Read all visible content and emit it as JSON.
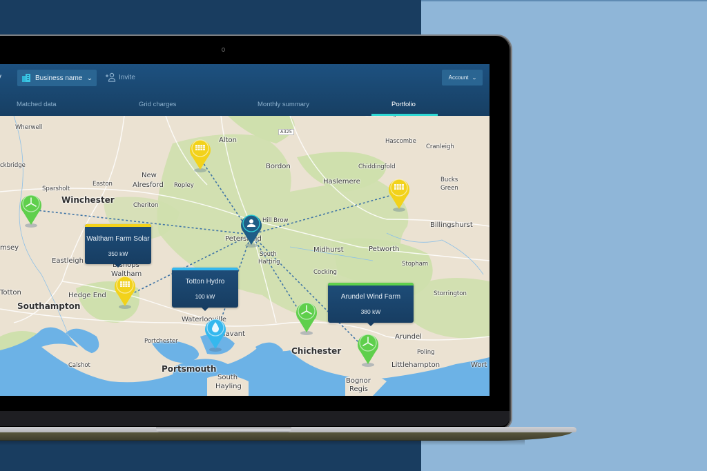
{
  "app": {
    "brand_fragment": "y",
    "business_selector": {
      "label": "Business name",
      "icon": "building-icon"
    },
    "invite": {
      "label": "Invite",
      "icon": "add-user-icon"
    },
    "account": {
      "label": "Account"
    }
  },
  "tabs": [
    {
      "label": "Matched data",
      "active": false
    },
    {
      "label": "Grid charges",
      "active": false
    },
    {
      "label": "Monthly summary",
      "active": false
    },
    {
      "label": "Portfolio",
      "active": true
    }
  ],
  "colors": {
    "accent_teal": "#2fd8d3",
    "solar": "#f2d21b",
    "wind": "#5fcf4c",
    "hydro": "#35b8ee",
    "hub": "#1f5d86",
    "header": "#1d5180",
    "water": "#6cb2e6"
  },
  "map": {
    "places": [
      {
        "name": "Wherwell",
        "size": "sm"
      },
      {
        "name": "Alton",
        "size": "md"
      },
      {
        "name": "A325",
        "size": "road"
      },
      {
        "name": "Godalming",
        "size": "sm"
      },
      {
        "name": "Hascombe",
        "size": "sm"
      },
      {
        "name": "Cranleigh",
        "size": "sm"
      },
      {
        "name": "ckbridge",
        "size": "sm"
      },
      {
        "name": "Bordon",
        "size": "md"
      },
      {
        "name": "Chiddingfold",
        "size": "sm"
      },
      {
        "name": "New",
        "size": "md"
      },
      {
        "name": "Alresford",
        "size": "md"
      },
      {
        "name": "Easton",
        "size": "sm"
      },
      {
        "name": "Ropley",
        "size": "sm"
      },
      {
        "name": "Haslemere",
        "size": "md"
      },
      {
        "name": "Bucks",
        "size": "sm"
      },
      {
        "name": "Green",
        "size": "sm"
      },
      {
        "name": "Sparsholt",
        "size": "sm"
      },
      {
        "name": "Winchester",
        "size": "lg"
      },
      {
        "name": "Cheriton",
        "size": "sm"
      },
      {
        "name": "Billingshurst",
        "size": "md"
      },
      {
        "name": "Hill Brow",
        "size": "sm"
      },
      {
        "name": "msey",
        "size": "md"
      },
      {
        "name": "Petersfield",
        "size": "md"
      },
      {
        "name": "Midhurst",
        "size": "md"
      },
      {
        "name": "Petworth",
        "size": "md"
      },
      {
        "name": "South",
        "size": "sm"
      },
      {
        "name": "Harting",
        "size": "sm"
      },
      {
        "name": "Eastleigh",
        "size": "md"
      },
      {
        "name": "Stopham",
        "size": "sm"
      },
      {
        "name": "Cocking",
        "size": "sm"
      },
      {
        "name": "Bishops",
        "size": "md"
      },
      {
        "name": "Waltham",
        "size": "md"
      },
      {
        "name": "Totton",
        "size": "md"
      },
      {
        "name": "Hedge End",
        "size": "md"
      },
      {
        "name": "Storrington",
        "size": "sm"
      },
      {
        "name": "Southampton",
        "size": "lg"
      },
      {
        "name": "Waterlooville",
        "size": "md"
      },
      {
        "name": "Havant",
        "size": "md"
      },
      {
        "name": "Arundel",
        "size": "md"
      },
      {
        "name": "Portchester",
        "size": "sm"
      },
      {
        "name": "Chichester",
        "size": "lg"
      },
      {
        "name": "Poling",
        "size": "sm"
      },
      {
        "name": "Calshot",
        "size": "sm"
      },
      {
        "name": "Littlehampton",
        "size": "md"
      },
      {
        "name": "Wort",
        "size": "md"
      },
      {
        "name": "Portsmouth",
        "size": "lg"
      },
      {
        "name": "South",
        "size": "md"
      },
      {
        "name": "Hayling",
        "size": "md"
      },
      {
        "name": "Bognor",
        "size": "md"
      },
      {
        "name": "Regis",
        "size": "md"
      }
    ],
    "hub": {
      "type": "user",
      "icon": "user-icon",
      "location": "Petersfield"
    },
    "sites": [
      {
        "id": "solar-alton",
        "type": "solar",
        "icon": "solar-panel-icon"
      },
      {
        "id": "solar-east",
        "type": "solar",
        "icon": "solar-panel-icon"
      },
      {
        "id": "wind-west",
        "type": "wind",
        "icon": "wind-turbine-icon"
      },
      {
        "id": "waltham-farm-solar",
        "type": "solar",
        "icon": "solar-panel-icon"
      },
      {
        "id": "totton-hydro",
        "type": "hydro",
        "icon": "water-drop-icon"
      },
      {
        "id": "wind-chichester",
        "type": "wind",
        "icon": "wind-turbine-icon"
      },
      {
        "id": "arundel-wind-farm",
        "type": "wind",
        "icon": "wind-turbine-icon"
      }
    ],
    "popups": [
      {
        "title": "Waltham Farm Solar",
        "value": "350 kW",
        "type": "solar"
      },
      {
        "title": "Totton Hydro",
        "value": "100 kW",
        "type": "hydro"
      },
      {
        "title": "Arundel Wind Farm",
        "value": "380 kW",
        "type": "wind"
      }
    ]
  }
}
